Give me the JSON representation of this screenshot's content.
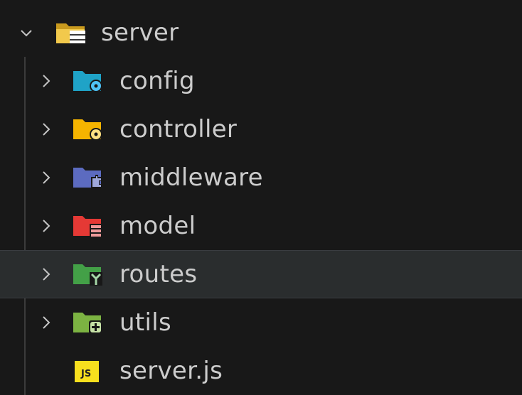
{
  "tree": {
    "root": {
      "label": "server",
      "expanded": true,
      "icon": "folder-open-server-icon",
      "color": "#f2c94c"
    },
    "children": [
      {
        "label": "config",
        "icon": "folder-config-icon",
        "color": "#1fa3c7",
        "badge_color": "#4fc3f7"
      },
      {
        "label": "controller",
        "icon": "folder-controller-icon",
        "color": "#f5b400",
        "badge_color": "#ffe082"
      },
      {
        "label": "middleware",
        "icon": "folder-middleware-icon",
        "color": "#5c6bc0",
        "badge_color": "#9fa8da"
      },
      {
        "label": "model",
        "icon": "folder-model-icon",
        "color": "#e53935",
        "badge_color": "#ef9a9a"
      },
      {
        "label": "routes",
        "icon": "folder-routes-icon",
        "color": "#43a047",
        "badge_color": "#a5d6a7"
      },
      {
        "label": "utils",
        "icon": "folder-utils-icon",
        "color": "#7cb342",
        "badge_color": "#c5e1a5"
      }
    ],
    "file": {
      "label": "server.js",
      "icon": "javascript-file-icon",
      "badge_text": "JS",
      "color": "#f7df1e"
    }
  },
  "colors": {
    "background": "#181818",
    "hover": "#2a2d2e",
    "text": "#cccccc",
    "chevron": "#c5c5c5"
  }
}
